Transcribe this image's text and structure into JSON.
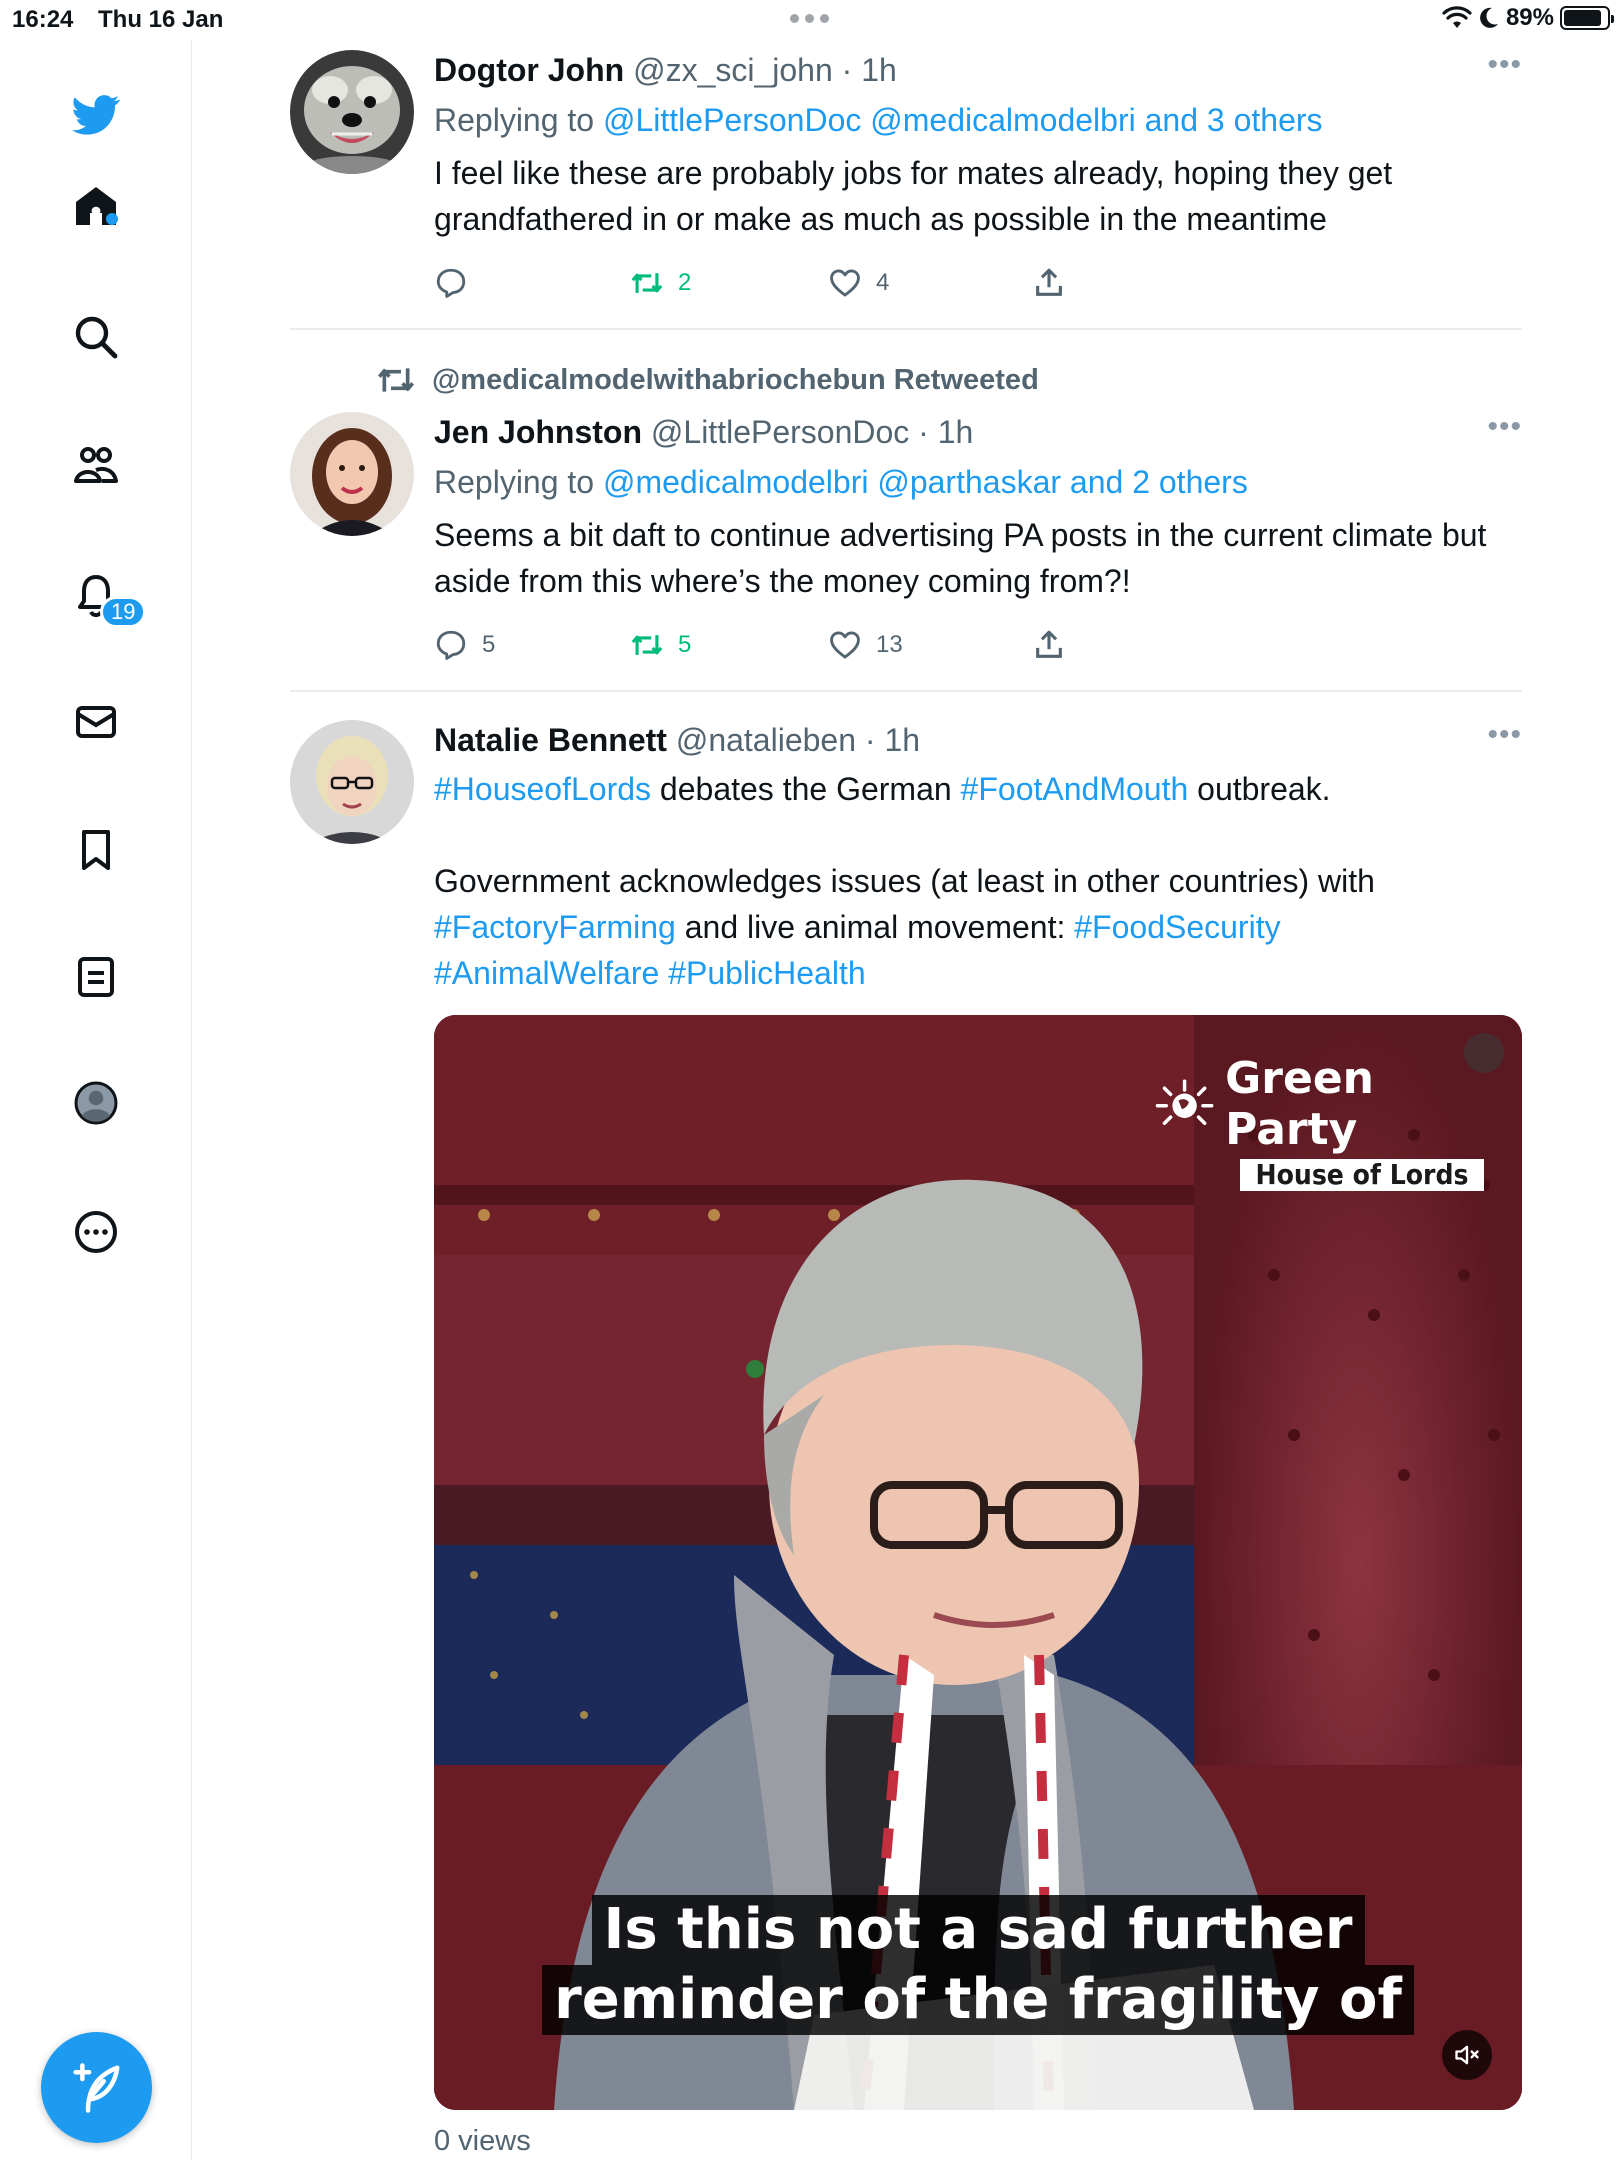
{
  "status_bar": {
    "time": "16:24",
    "date": "Thu 16 Jan",
    "battery": "89%",
    "battery_level": 0.89
  },
  "sidebar": {
    "items": [
      {
        "name": "home",
        "icon": "home-icon"
      },
      {
        "name": "explore",
        "icon": "search-icon"
      },
      {
        "name": "communities",
        "icon": "people-icon"
      },
      {
        "name": "notifications",
        "icon": "bell-icon",
        "badge": "19"
      },
      {
        "name": "messages",
        "icon": "mail-icon"
      },
      {
        "name": "bookmarks",
        "icon": "bookmark-icon"
      },
      {
        "name": "lists",
        "icon": "list-icon"
      },
      {
        "name": "profile",
        "icon": "profile-icon"
      },
      {
        "name": "more",
        "icon": "more-circle-icon"
      }
    ],
    "compose_icon": "compose-icon"
  },
  "tweets": [
    {
      "name": "Dogtor John",
      "handle": "@zx_sci_john",
      "time": "· 1h",
      "replying_prefix": "Replying to",
      "replying_to": "@LittlePersonDoc @medicalmodelbri and 3 others",
      "text": "I feel like these are probably jobs for mates already, hoping they get grandfathered in or make as much as possible in the meantime",
      "replies": "",
      "retweets": "2",
      "likes": "4"
    },
    {
      "retweeted_by": "@medicalmodelwithabriochebun Retweeted",
      "name": "Jen Johnston",
      "handle": "@LittlePersonDoc",
      "time": "· 1h",
      "replying_prefix": "Replying to",
      "replying_to": "@medicalmodelbri @parthaskar and 2 others",
      "text": "Seems a bit daft to continue advertising PA posts in the current climate but aside from this where’s the money coming from?!",
      "replies": "5",
      "retweets": "5",
      "likes": "13"
    },
    {
      "name": "Natalie Bennett",
      "handle": "@natalieben",
      "time": "· 1h",
      "text_parts": {
        "tag1": "#HouseofLords",
        "t1": " debates the German ",
        "tag2": "#FootAndMouth",
        "t2": " outbreak.",
        "p2": "Government acknowledges issues (at least in other countries) with ",
        "tag3": "#FactoryFarming",
        "t3": " and live animal movement: ",
        "tag4": "#FoodSecurity",
        "tag5": "#AnimalWelfare",
        "tag6": "#PublicHealth"
      },
      "media": {
        "logo_title": "Green Party",
        "logo_subtitle": "House of Lords",
        "caption_line1": "Is this not a sad further",
        "caption_line2": "reminder of the fragility of"
      },
      "views": "0 views"
    }
  ],
  "colors": {
    "accent": "#1d9bf0",
    "retweet": "#00ba7c",
    "muted": "#536471"
  }
}
